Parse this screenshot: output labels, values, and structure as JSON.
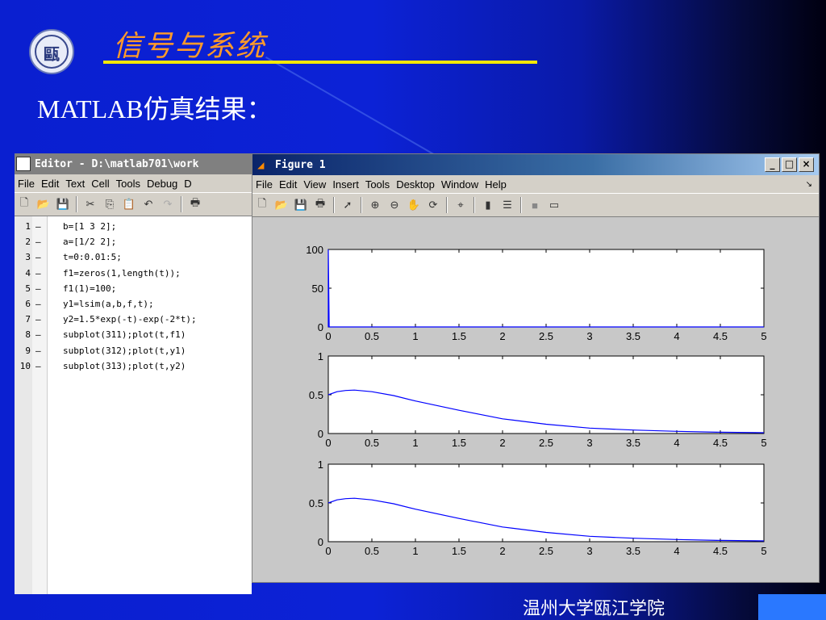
{
  "slide": {
    "title": "信号与系统",
    "subtitle": "MATLAB仿真结果：",
    "footer": "温州大学瓯江学院",
    "logo_char": "甌"
  },
  "editor": {
    "title": "Editor - D:\\matlab701\\work",
    "menu": [
      "File",
      "Edit",
      "Text",
      "Cell",
      "Tools",
      "Debug",
      "D"
    ],
    "toolbar_icons": [
      "new-icon",
      "open-icon",
      "save-icon",
      "cut-icon",
      "copy-icon",
      "paste-icon",
      "undo-icon",
      "redo-icon",
      "print-icon"
    ],
    "lines": [
      {
        "n": "1",
        "code": "b=[1 3 2];"
      },
      {
        "n": "2",
        "code": "a=[1/2 2];"
      },
      {
        "n": "3",
        "code": "t=0:0.01:5;"
      },
      {
        "n": "4",
        "code": "f1=zeros(1,length(t));"
      },
      {
        "n": "5",
        "code": "f1(1)=100;"
      },
      {
        "n": "6",
        "code": "y1=lsim(a,b,f,t);"
      },
      {
        "n": "7",
        "code": "y2=1.5*exp(-t)-exp(-2*t);"
      },
      {
        "n": "8",
        "code": "subplot(311);plot(t,f1)"
      },
      {
        "n": "9",
        "code": "subplot(312);plot(t,y1)"
      },
      {
        "n": "10",
        "code": "subplot(313);plot(t,y2)"
      }
    ]
  },
  "figure": {
    "title": "Figure 1",
    "menu": [
      "File",
      "Edit",
      "View",
      "Insert",
      "Tools",
      "Desktop",
      "Window",
      "Help"
    ],
    "window_buttons": [
      "_",
      "□",
      "×"
    ],
    "toolbar_icons": [
      "new-icon",
      "open-icon",
      "save-icon",
      "print-icon",
      "pointer-icon",
      "zoom-in-icon",
      "zoom-out-icon",
      "pan-icon",
      "rotate-icon",
      "data-cursor-icon",
      "colorbar-icon",
      "legend-icon",
      "hide-plot-tools-icon",
      "show-plot-tools-icon"
    ]
  },
  "chart_data": [
    {
      "type": "line",
      "x_ticks": [
        "0",
        "0.5",
        "1",
        "1.5",
        "2",
        "2.5",
        "3",
        "3.5",
        "4",
        "4.5",
        "5"
      ],
      "y_ticks": [
        "0",
        "50",
        "100"
      ],
      "xlim": [
        0,
        5
      ],
      "ylim": [
        0,
        100
      ],
      "series": [
        {
          "x": [
            0,
            0,
            0.01,
            5
          ],
          "y": [
            0,
            100,
            0,
            0
          ],
          "color": "#0000ff"
        }
      ]
    },
    {
      "type": "line",
      "x_ticks": [
        "0",
        "0.5",
        "1",
        "1.5",
        "2",
        "2.5",
        "3",
        "3.5",
        "4",
        "4.5",
        "5"
      ],
      "y_ticks": [
        "0",
        "0.5",
        "1"
      ],
      "xlim": [
        0,
        5
      ],
      "ylim": [
        0,
        1
      ],
      "series": [
        {
          "x": [
            0,
            0.1,
            0.2,
            0.3,
            0.5,
            0.75,
            1,
            1.5,
            2,
            2.5,
            3,
            3.5,
            4,
            4.5,
            5
          ],
          "y": [
            0.5,
            0.54,
            0.555,
            0.56,
            0.54,
            0.49,
            0.42,
            0.3,
            0.19,
            0.12,
            0.07,
            0.045,
            0.028,
            0.017,
            0.01
          ],
          "color": "#0000ff"
        }
      ]
    },
    {
      "type": "line",
      "x_ticks": [
        "0",
        "0.5",
        "1",
        "1.5",
        "2",
        "2.5",
        "3",
        "3.5",
        "4",
        "4.5",
        "5"
      ],
      "y_ticks": [
        "0",
        "0.5",
        "1"
      ],
      "xlim": [
        0,
        5
      ],
      "ylim": [
        0,
        1
      ],
      "series": [
        {
          "x": [
            0,
            0.1,
            0.2,
            0.3,
            0.5,
            0.75,
            1,
            1.5,
            2,
            2.5,
            3,
            3.5,
            4,
            4.5,
            5
          ],
          "y": [
            0.5,
            0.54,
            0.555,
            0.56,
            0.54,
            0.49,
            0.42,
            0.3,
            0.19,
            0.12,
            0.07,
            0.045,
            0.028,
            0.017,
            0.01
          ],
          "color": "#0000ff"
        }
      ]
    }
  ]
}
